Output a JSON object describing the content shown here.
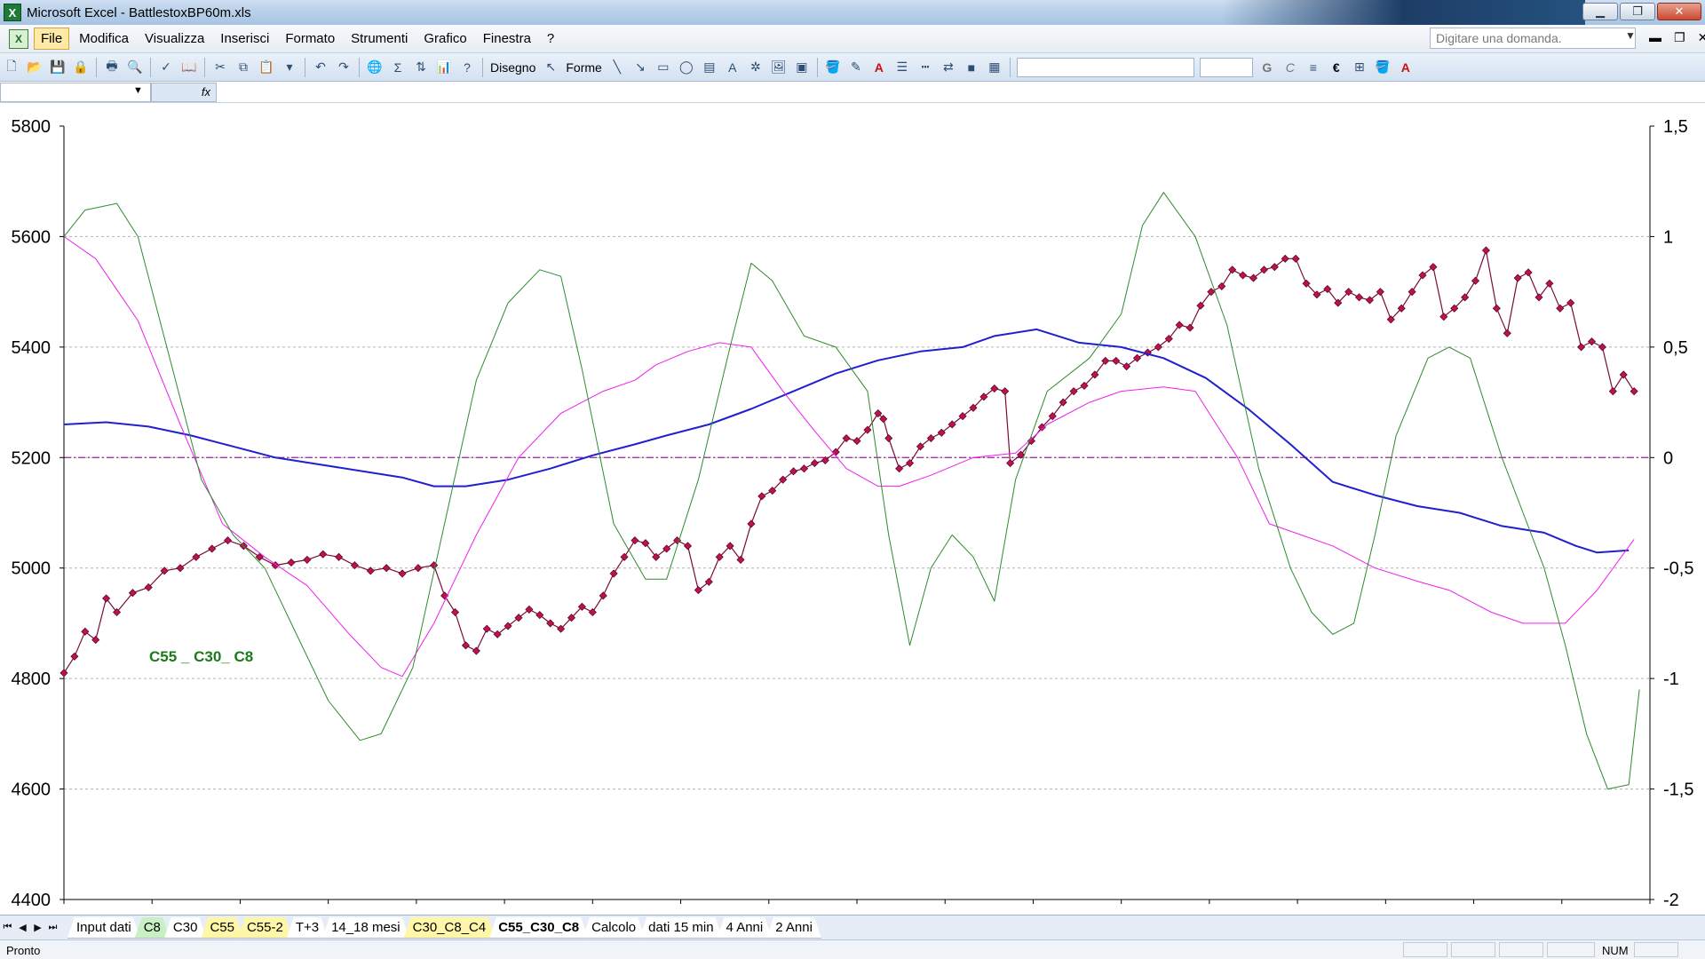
{
  "window": {
    "title": "Microsoft Excel - BattlestoxBP60m.xls",
    "app_icon_text": "X"
  },
  "menu": {
    "items": [
      "File",
      "Modifica",
      "Visualizza",
      "Inserisci",
      "Formato",
      "Strumenti",
      "Grafico",
      "Finestra",
      "?"
    ],
    "ask_placeholder": "Digitare una domanda."
  },
  "toolbar": {
    "draw_label": "Disegno",
    "shapes_label": "Forme",
    "bold": "G",
    "italic": "C",
    "euro": "€"
  },
  "formula": {
    "fx": "fx"
  },
  "sheet_tabs": [
    {
      "label": "Input dati",
      "color": "none"
    },
    {
      "label": "C8",
      "color": "green"
    },
    {
      "label": "C30",
      "color": "none"
    },
    {
      "label": "C55",
      "color": "yellow"
    },
    {
      "label": "C55-2",
      "color": "yellow"
    },
    {
      "label": "T+3",
      "color": "none"
    },
    {
      "label": "14_18 mesi",
      "color": "none"
    },
    {
      "label": "C30_C8_C4",
      "color": "yellow"
    },
    {
      "label": "C55_C30_C8",
      "color": "active"
    },
    {
      "label": "Calcolo",
      "color": "none"
    },
    {
      "label": "dati 15 min",
      "color": "none"
    },
    {
      "label": "4 Anni",
      "color": "none"
    },
    {
      "label": "2 Anni",
      "color": "none"
    }
  ],
  "status": {
    "left": "Pronto",
    "num": "NUM"
  },
  "chart_data": {
    "type": "line",
    "annotation": "C55 _ C30_ C8",
    "annotation_color": "#1a7a1a",
    "y_left": {
      "min": 4400,
      "max": 5800,
      "ticks": [
        "5800",
        "5600",
        "5400",
        "5200",
        "5000",
        "4800",
        "4600",
        "4400"
      ]
    },
    "y_right": {
      "min": -2,
      "max": 1.5,
      "ticks": [
        "1,5",
        "1",
        "0,5",
        "0",
        "-0,5",
        "-1",
        "-1,5",
        "-2"
      ]
    },
    "zero_line_color": "#a020a0",
    "grid": true,
    "series": [
      {
        "axis": "left",
        "color": "#7a0a3a",
        "marker": "diamond",
        "marker_color": "#c01050",
        "points": [
          [
            0,
            4810
          ],
          [
            2,
            4840
          ],
          [
            4,
            4885
          ],
          [
            6,
            4870
          ],
          [
            8,
            4945
          ],
          [
            10,
            4920
          ],
          [
            13,
            4955
          ],
          [
            16,
            4965
          ],
          [
            19,
            4995
          ],
          [
            22,
            5000
          ],
          [
            25,
            5020
          ],
          [
            28,
            5035
          ],
          [
            31,
            5050
          ],
          [
            34,
            5040
          ],
          [
            37,
            5020
          ],
          [
            40,
            5005
          ],
          [
            43,
            5010
          ],
          [
            46,
            5015
          ],
          [
            49,
            5025
          ],
          [
            52,
            5020
          ],
          [
            55,
            5005
          ],
          [
            58,
            4995
          ],
          [
            61,
            5000
          ],
          [
            64,
            4990
          ],
          [
            67,
            5000
          ],
          [
            70,
            5005
          ],
          [
            72,
            4950
          ],
          [
            74,
            4920
          ],
          [
            76,
            4860
          ],
          [
            78,
            4850
          ],
          [
            80,
            4890
          ],
          [
            82,
            4880
          ],
          [
            84,
            4895
          ],
          [
            86,
            4910
          ],
          [
            88,
            4925
          ],
          [
            90,
            4915
          ],
          [
            92,
            4900
          ],
          [
            94,
            4890
          ],
          [
            96,
            4910
          ],
          [
            98,
            4930
          ],
          [
            100,
            4920
          ],
          [
            102,
            4950
          ],
          [
            104,
            4990
          ],
          [
            106,
            5020
          ],
          [
            108,
            5050
          ],
          [
            110,
            5045
          ],
          [
            112,
            5020
          ],
          [
            114,
            5035
          ],
          [
            116,
            5050
          ],
          [
            118,
            5040
          ],
          [
            120,
            4960
          ],
          [
            122,
            4975
          ],
          [
            124,
            5020
          ],
          [
            126,
            5040
          ],
          [
            128,
            5015
          ],
          [
            130,
            5080
          ],
          [
            132,
            5130
          ],
          [
            134,
            5140
          ],
          [
            136,
            5160
          ],
          [
            138,
            5175
          ],
          [
            140,
            5180
          ],
          [
            142,
            5190
          ],
          [
            144,
            5195
          ],
          [
            146,
            5210
          ],
          [
            148,
            5235
          ],
          [
            150,
            5230
          ],
          [
            152,
            5250
          ],
          [
            154,
            5280
          ],
          [
            155,
            5270
          ],
          [
            156,
            5235
          ],
          [
            158,
            5180
          ],
          [
            160,
            5190
          ],
          [
            162,
            5220
          ],
          [
            164,
            5235
          ],
          [
            166,
            5245
          ],
          [
            168,
            5260
          ],
          [
            170,
            5275
          ],
          [
            172,
            5290
          ],
          [
            174,
            5310
          ],
          [
            176,
            5325
          ],
          [
            178,
            5320
          ],
          [
            179,
            5190
          ],
          [
            181,
            5205
          ],
          [
            183,
            5230
          ],
          [
            185,
            5255
          ],
          [
            187,
            5275
          ],
          [
            189,
            5300
          ],
          [
            191,
            5320
          ],
          [
            193,
            5330
          ],
          [
            195,
            5350
          ],
          [
            197,
            5375
          ],
          [
            199,
            5375
          ],
          [
            201,
            5365
          ],
          [
            203,
            5380
          ],
          [
            205,
            5390
          ],
          [
            207,
            5400
          ],
          [
            209,
            5415
          ],
          [
            211,
            5440
          ],
          [
            213,
            5435
          ],
          [
            215,
            5475
          ],
          [
            217,
            5500
          ],
          [
            219,
            5510
          ],
          [
            221,
            5540
          ],
          [
            223,
            5530
          ],
          [
            225,
            5525
          ],
          [
            227,
            5540
          ],
          [
            229,
            5545
          ],
          [
            231,
            5560
          ],
          [
            233,
            5560
          ],
          [
            235,
            5515
          ],
          [
            237,
            5495
          ],
          [
            239,
            5505
          ],
          [
            241,
            5480
          ],
          [
            243,
            5500
          ],
          [
            245,
            5490
          ],
          [
            247,
            5485
          ],
          [
            249,
            5500
          ],
          [
            251,
            5450
          ],
          [
            253,
            5470
          ],
          [
            255,
            5500
          ],
          [
            257,
            5530
          ],
          [
            259,
            5545
          ],
          [
            261,
            5455
          ],
          [
            263,
            5470
          ],
          [
            265,
            5490
          ],
          [
            267,
            5520
          ],
          [
            269,
            5575
          ],
          [
            271,
            5470
          ],
          [
            273,
            5425
          ],
          [
            275,
            5525
          ],
          [
            277,
            5535
          ],
          [
            279,
            5490
          ],
          [
            281,
            5515
          ],
          [
            283,
            5470
          ],
          [
            285,
            5480
          ],
          [
            287,
            5400
          ],
          [
            289,
            5410
          ],
          [
            291,
            5400
          ],
          [
            293,
            5320
          ],
          [
            295,
            5350
          ],
          [
            297,
            5320
          ]
        ]
      },
      {
        "axis": "right",
        "color": "#2020d0",
        "width": 2,
        "points": [
          [
            0,
            0.15
          ],
          [
            8,
            0.16
          ],
          [
            16,
            0.14
          ],
          [
            24,
            0.1
          ],
          [
            32,
            0.05
          ],
          [
            40,
            0.0
          ],
          [
            48,
            -0.03
          ],
          [
            56,
            -0.06
          ],
          [
            64,
            -0.09
          ],
          [
            70,
            -0.13
          ],
          [
            76,
            -0.13
          ],
          [
            84,
            -0.1
          ],
          [
            92,
            -0.05
          ],
          [
            100,
            0.01
          ],
          [
            108,
            0.06
          ],
          [
            114,
            0.1
          ],
          [
            122,
            0.15
          ],
          [
            130,
            0.22
          ],
          [
            138,
            0.3
          ],
          [
            146,
            0.38
          ],
          [
            154,
            0.44
          ],
          [
            162,
            0.48
          ],
          [
            170,
            0.5
          ],
          [
            176,
            0.55
          ],
          [
            184,
            0.58
          ],
          [
            192,
            0.52
          ],
          [
            200,
            0.5
          ],
          [
            208,
            0.45
          ],
          [
            216,
            0.36
          ],
          [
            224,
            0.22
          ],
          [
            232,
            0.06
          ],
          [
            240,
            -0.11
          ],
          [
            248,
            -0.17
          ],
          [
            256,
            -0.22
          ],
          [
            264,
            -0.25
          ],
          [
            272,
            -0.31
          ],
          [
            280,
            -0.34
          ],
          [
            286,
            -0.4
          ],
          [
            290,
            -0.43
          ],
          [
            296,
            -0.42
          ]
        ]
      },
      {
        "axis": "right",
        "color": "#ee20ee",
        "width": 1,
        "points": [
          [
            0,
            1.0
          ],
          [
            6,
            0.9
          ],
          [
            14,
            0.62
          ],
          [
            22,
            0.15
          ],
          [
            30,
            -0.3
          ],
          [
            38,
            -0.45
          ],
          [
            46,
            -0.58
          ],
          [
            54,
            -0.8
          ],
          [
            60,
            -0.95
          ],
          [
            64,
            -0.99
          ],
          [
            70,
            -0.75
          ],
          [
            78,
            -0.35
          ],
          [
            86,
            0.0
          ],
          [
            94,
            0.2
          ],
          [
            102,
            0.3
          ],
          [
            108,
            0.35
          ],
          [
            112,
            0.42
          ],
          [
            118,
            0.48
          ],
          [
            124,
            0.52
          ],
          [
            130,
            0.5
          ],
          [
            136,
            0.3
          ],
          [
            142,
            0.12
          ],
          [
            148,
            -0.05
          ],
          [
            154,
            -0.13
          ],
          [
            158,
            -0.13
          ],
          [
            164,
            -0.08
          ],
          [
            172,
            -0.0
          ],
          [
            180,
            0.02
          ],
          [
            186,
            0.15
          ],
          [
            194,
            0.25
          ],
          [
            200,
            0.3
          ],
          [
            208,
            0.32
          ],
          [
            214,
            0.3
          ],
          [
            222,
            0.0
          ],
          [
            228,
            -0.3
          ],
          [
            234,
            -0.35
          ],
          [
            240,
            -0.4
          ],
          [
            248,
            -0.5
          ],
          [
            256,
            -0.56
          ],
          [
            262,
            -0.6
          ],
          [
            270,
            -0.7
          ],
          [
            276,
            -0.75
          ],
          [
            284,
            -0.75
          ],
          [
            290,
            -0.6
          ],
          [
            297,
            -0.37
          ]
        ]
      },
      {
        "axis": "right",
        "color": "#2e8b2e",
        "width": 1,
        "points": [
          [
            0,
            1.0
          ],
          [
            4,
            1.12
          ],
          [
            10,
            1.15
          ],
          [
            14,
            1.0
          ],
          [
            20,
            0.45
          ],
          [
            26,
            -0.1
          ],
          [
            32,
            -0.35
          ],
          [
            38,
            -0.5
          ],
          [
            44,
            -0.8
          ],
          [
            50,
            -1.1
          ],
          [
            56,
            -1.28
          ],
          [
            60,
            -1.25
          ],
          [
            66,
            -0.95
          ],
          [
            72,
            -0.3
          ],
          [
            78,
            0.35
          ],
          [
            84,
            0.7
          ],
          [
            90,
            0.85
          ],
          [
            94,
            0.82
          ],
          [
            98,
            0.4
          ],
          [
            104,
            -0.3
          ],
          [
            110,
            -0.55
          ],
          [
            114,
            -0.55
          ],
          [
            120,
            -0.1
          ],
          [
            126,
            0.5
          ],
          [
            130,
            0.88
          ],
          [
            134,
            0.8
          ],
          [
            140,
            0.55
          ],
          [
            146,
            0.5
          ],
          [
            152,
            0.3
          ],
          [
            156,
            -0.35
          ],
          [
            160,
            -0.85
          ],
          [
            164,
            -0.5
          ],
          [
            168,
            -0.35
          ],
          [
            172,
            -0.45
          ],
          [
            176,
            -0.65
          ],
          [
            180,
            -0.1
          ],
          [
            186,
            0.3
          ],
          [
            194,
            0.45
          ],
          [
            200,
            0.65
          ],
          [
            204,
            1.05
          ],
          [
            208,
            1.2
          ],
          [
            214,
            1.0
          ],
          [
            220,
            0.6
          ],
          [
            226,
            -0.05
          ],
          [
            232,
            -0.5
          ],
          [
            236,
            -0.7
          ],
          [
            240,
            -0.8
          ],
          [
            244,
            -0.75
          ],
          [
            248,
            -0.35
          ],
          [
            252,
            0.1
          ],
          [
            258,
            0.45
          ],
          [
            262,
            0.5
          ],
          [
            266,
            0.45
          ],
          [
            272,
            0.0
          ],
          [
            276,
            -0.25
          ],
          [
            280,
            -0.5
          ],
          [
            284,
            -0.85
          ],
          [
            288,
            -1.25
          ],
          [
            292,
            -1.5
          ],
          [
            296,
            -1.48
          ],
          [
            298,
            -1.05
          ]
        ]
      }
    ]
  }
}
